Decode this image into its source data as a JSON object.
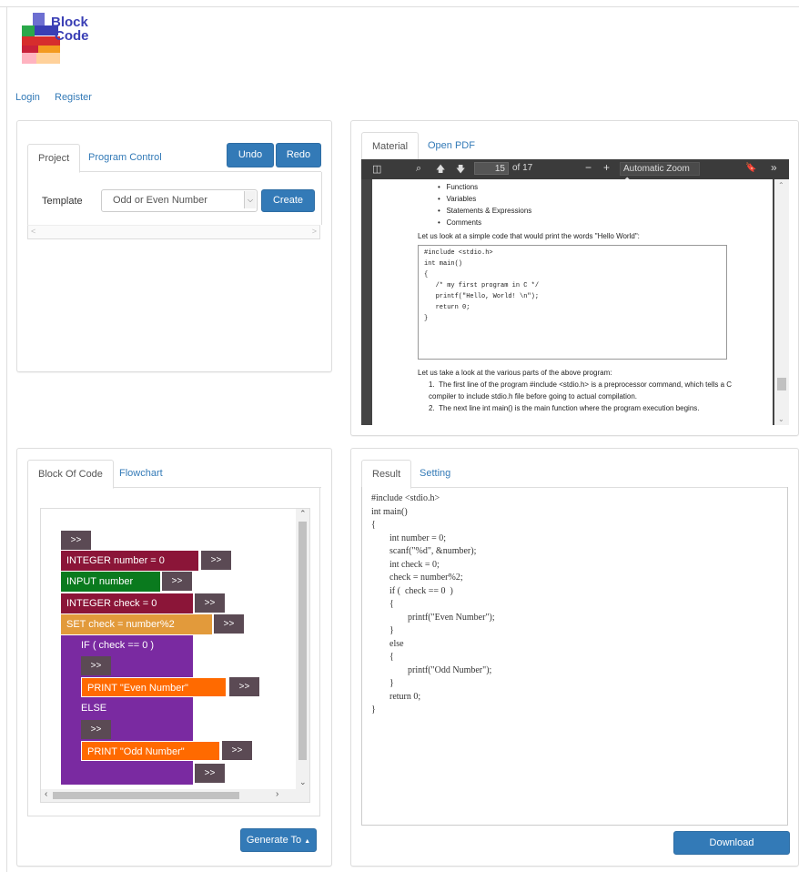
{
  "logo": {
    "line1": "Block",
    "line2": "Code"
  },
  "nav": {
    "login": "Login",
    "register": "Register"
  },
  "project_panel": {
    "tabs": [
      "Project",
      "Program Control"
    ],
    "undo": "Undo",
    "redo": "Redo",
    "template_label": "Template",
    "template_value": "Odd or Even Number",
    "create": "Create"
  },
  "material_panel": {
    "tabs": [
      "Material",
      "Open PDF"
    ],
    "pdf": {
      "page_number": "15",
      "page_count": "of 17",
      "zoom": "Automatic Zoom",
      "bullets": [
        "Functions",
        "Variables",
        "Statements & Expressions",
        "Comments"
      ],
      "intro": "Let us look at a simple code that would print the words \"Hello World\":",
      "code": [
        "#include <stdio.h>",
        "",
        "int main()",
        "{",
        "   /* my first program in C */",
        "   printf(\"Hello, World! \\n\");",
        "",
        "   return 0;",
        "}"
      ],
      "parts_intro": "Let us take a look at the various parts of the above program:",
      "items": [
        "The first line of the program #include <stdio.h> is a preprocessor command, which tells a C compiler to include stdio.h file before going to actual compilation.",
        "The next line int main() is the main function where the program execution begins."
      ]
    }
  },
  "blocks_panel": {
    "tabs": [
      "Block Of Code",
      "Flowchart"
    ],
    "arrow": ">>",
    "blocks": {
      "int_number": "INTEGER  number = 0",
      "input_number": "INPUT  number",
      "int_check": "INTEGER  check = 0",
      "set_check": "SET  check = number%2",
      "if_check": "IF ( check == 0  )",
      "print_even": "PRINT  \"Even Number\"",
      "else": "ELSE",
      "print_odd": "PRINT  \"Odd Number\""
    },
    "generate": "Generate To"
  },
  "result_panel": {
    "tabs": [
      "Result",
      "Setting"
    ],
    "code_lines": [
      "#include <stdio.h>",
      "",
      "int main()",
      "{",
      "        int number = 0;",
      "        scanf(\"%d\", &number);",
      "        int check = 0;",
      "        check = number%2;",
      "        if (  check == 0  )",
      "        {",
      "                printf(\"Even Number\");",
      "        }",
      "        else",
      "        {",
      "                printf(\"Odd Number\");",
      "        }",
      "        return 0;",
      "}"
    ],
    "download": "Download"
  },
  "colors": {
    "primary": "#337ab7",
    "block_maroon": "#8b1538",
    "block_green": "#0a7a1e",
    "block_orange_light": "#e29a3b",
    "block_purple": "#7a2aa1",
    "block_orange": "#ff6a00",
    "arrow_gray": "#5b4a54"
  }
}
